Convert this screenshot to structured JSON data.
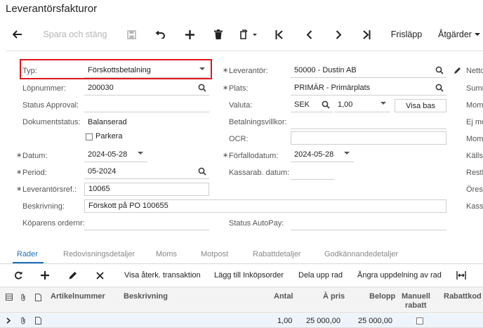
{
  "page_title": "Leverantörsfakturor",
  "toolbar": {
    "save_close": "Spara och stäng",
    "frislapp": "Frisläpp",
    "atgarder": "Åtgärder"
  },
  "form": {
    "typ_label": "Typ:",
    "typ_value": "Förskottsbetalning",
    "lopnummer_label": "Löpnummer:",
    "lopnummer_value": "200030",
    "status_approval_label": "Status Approval:",
    "dokumentstatus_label": "Dokumentstatus:",
    "dokumentstatus_value": "Balanserad",
    "parkera_label": "Parkera",
    "datum_label": "Datum:",
    "datum_value": "2024-05-28",
    "period_label": "Period:",
    "period_value": "05-2024",
    "leverantorsref_label": "Leverantörsref.:",
    "leverantorsref_value": "10065",
    "beskrivning_label": "Beskrivning:",
    "beskrivning_value": "Förskott på PO 100655",
    "koparens_ordernr_label": "Köparens ordernr:",
    "leverantor_label": "Leverantör:",
    "leverantor_value": "50000 - Dustin AB",
    "plats_label": "Plats:",
    "plats_value": "PRIMÄR - Primärplats",
    "valuta_label": "Valuta:",
    "valuta_value": "SEK",
    "kurs_value": "1,00",
    "visa_bas": "Visa bas",
    "betalningsvillkor_label": "Betalningsvillkor:",
    "ocr_label": "OCR:",
    "forfallodatum_label": "Förfallodatum:",
    "forfallodatum_value": "2024-05-28",
    "kassarab_datum_label": "Kassarab. datum:",
    "status_autopay_label": "Status AutoPay:",
    "right_labels": [
      "Netto",
      "Summ",
      "Moms",
      "Ej mo",
      "Moms",
      "Källs",
      "Restb",
      "Öres",
      "Kass"
    ]
  },
  "tabs": [
    "Rader",
    "Redovisningsdetaljer",
    "Moms",
    "Motpost",
    "Rabattdetaljer",
    "Godkännandedetaljer"
  ],
  "grid_toolbar": {
    "visa_aterk": "Visa återk. transaktion",
    "lagg_till": "Lägg till Inköpsorder",
    "dela_upp": "Dela upp rad",
    "angra": "Ångra uppdelning av rad"
  },
  "grid": {
    "headers": {
      "artikelnummer": "Artikelnummer",
      "beskrivning": "Beskrivning",
      "antal": "Antal",
      "a_pris": "À pris",
      "belopp": "Belopp",
      "manuell_rabatt_1": "Manuell",
      "manuell_rabatt_2": "rabatt",
      "rabattkod": "Rabattkod"
    },
    "rows": [
      {
        "antal": "1,00",
        "a_pris": "25 000,00",
        "belopp": "25 000,00"
      }
    ]
  }
}
